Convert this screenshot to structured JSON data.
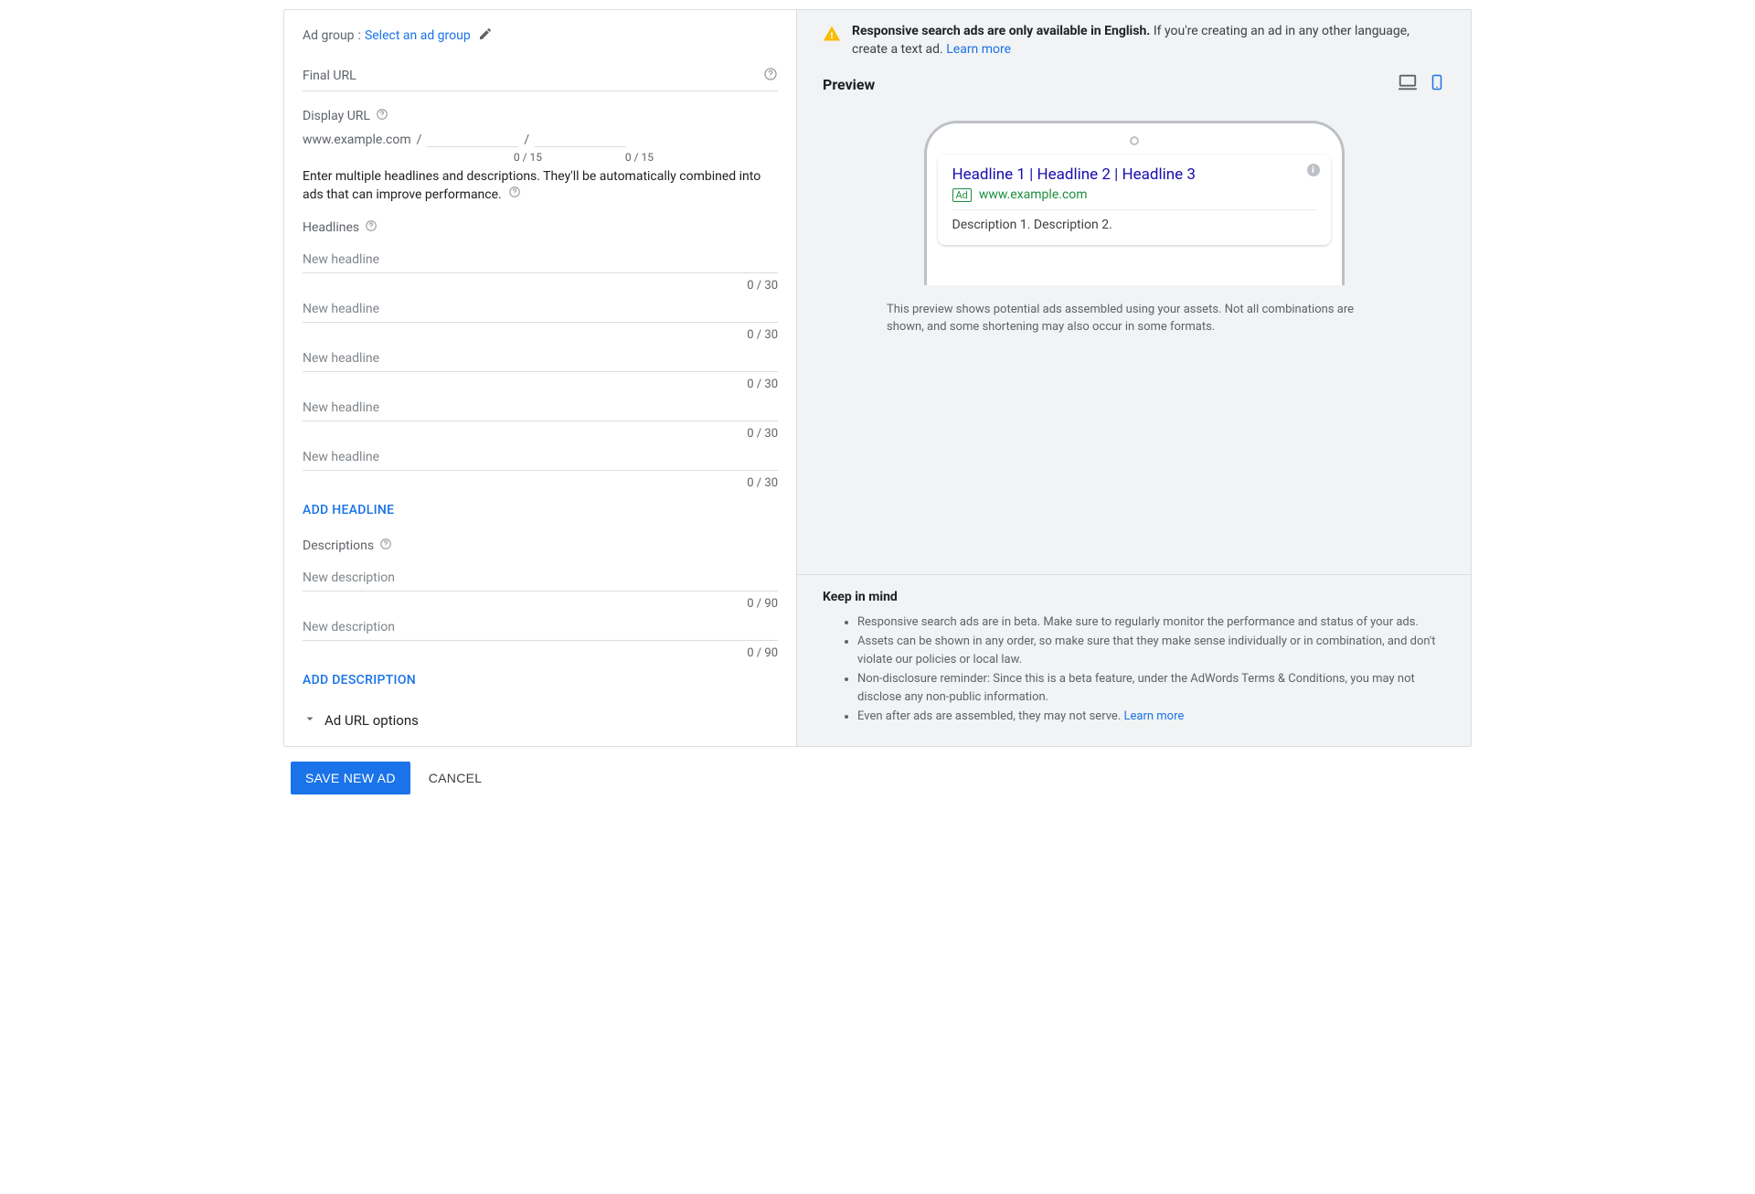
{
  "adGroup": {
    "label": "Ad group",
    "link": "Select an ad group"
  },
  "finalUrl": {
    "label": "Final URL"
  },
  "displayUrl": {
    "label": "Display URL",
    "domain": "www.example.com",
    "sep": "/",
    "counter1": "0 / 15",
    "counter2": "0 / 15"
  },
  "instruction": "Enter multiple headlines and descriptions. They'll be automatically combined into ads that can improve performance.",
  "headlines": {
    "label": "Headlines",
    "placeholder": "New headline",
    "counter": "0 / 30",
    "addLabel": "ADD HEADLINE",
    "items": [
      {},
      {},
      {},
      {},
      {}
    ]
  },
  "descriptions": {
    "label": "Descriptions",
    "placeholder": "New description",
    "counter": "0 / 90",
    "addLabel": "ADD DESCRIPTION",
    "items": [
      {},
      {}
    ]
  },
  "adUrlOptions": "Ad URL options",
  "notice": {
    "bold": "Responsive search ads are only available in English.",
    "rest": " If you're creating an ad in any other language, create a text ad. ",
    "learn": "Learn more"
  },
  "preview": {
    "title": "Preview",
    "headline": "Headline 1 | Headline 2 | Headline 3",
    "adBadge": "Ad",
    "url": "www.example.com",
    "desc": "Description 1. Description 2.",
    "note": "This preview shows potential ads assembled using your assets. Not all combinations are shown, and some shortening may also occur in some formats."
  },
  "keepInMind": {
    "title": "Keep in mind",
    "items": [
      "Responsive search ads are in beta. Make sure to regularly monitor the performance and status of your ads.",
      "Assets can be shown in any order, so make sure that they make sense individually or in combination, and don't violate our policies or local law.",
      "Non-disclosure reminder: Since this is a beta feature, under the AdWords Terms & Conditions, you may not disclose any non-public information."
    ],
    "lastItemPrefix": "Even after ads are assembled, they may not serve. ",
    "learn": "Learn more"
  },
  "footer": {
    "save": "SAVE NEW AD",
    "cancel": "CANCEL"
  }
}
